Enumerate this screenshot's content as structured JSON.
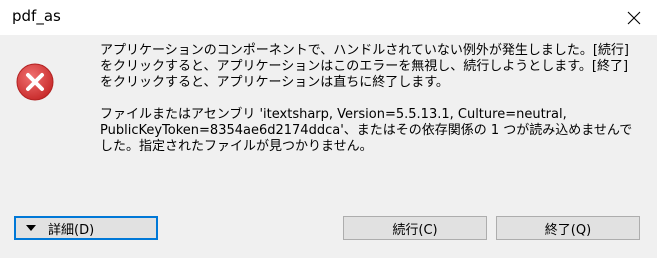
{
  "window": {
    "title": "pdf_as",
    "close_icon": "close-icon"
  },
  "message": {
    "icon": "error-icon",
    "paragraph1": "アプリケーションのコンポーネントで、ハンドルされていない例外が発生しました。[続行] をクリックすると、アプリケーションはこのエラーを無視し、続行しようとします。[終了] をクリックすると、アプリケーションは直ちに終了します。",
    "paragraph2": "ファイルまたはアセンブリ 'itextsharp, Version=5.5.13.1, Culture=neutral, PublicKeyToken=8354ae6d2174ddca'、またはその依存関係の 1 つが読み込めませんでした。指定されたファイルが見つかりません。"
  },
  "buttons": {
    "details": "詳細(D)",
    "details_icon": "triangle-down-icon",
    "continue": "続行(C)",
    "quit": "終了(Q)"
  },
  "colors": {
    "error_red": "#e04343",
    "focus_border": "#0078d7",
    "panel_bg": "#f0f0f0"
  }
}
